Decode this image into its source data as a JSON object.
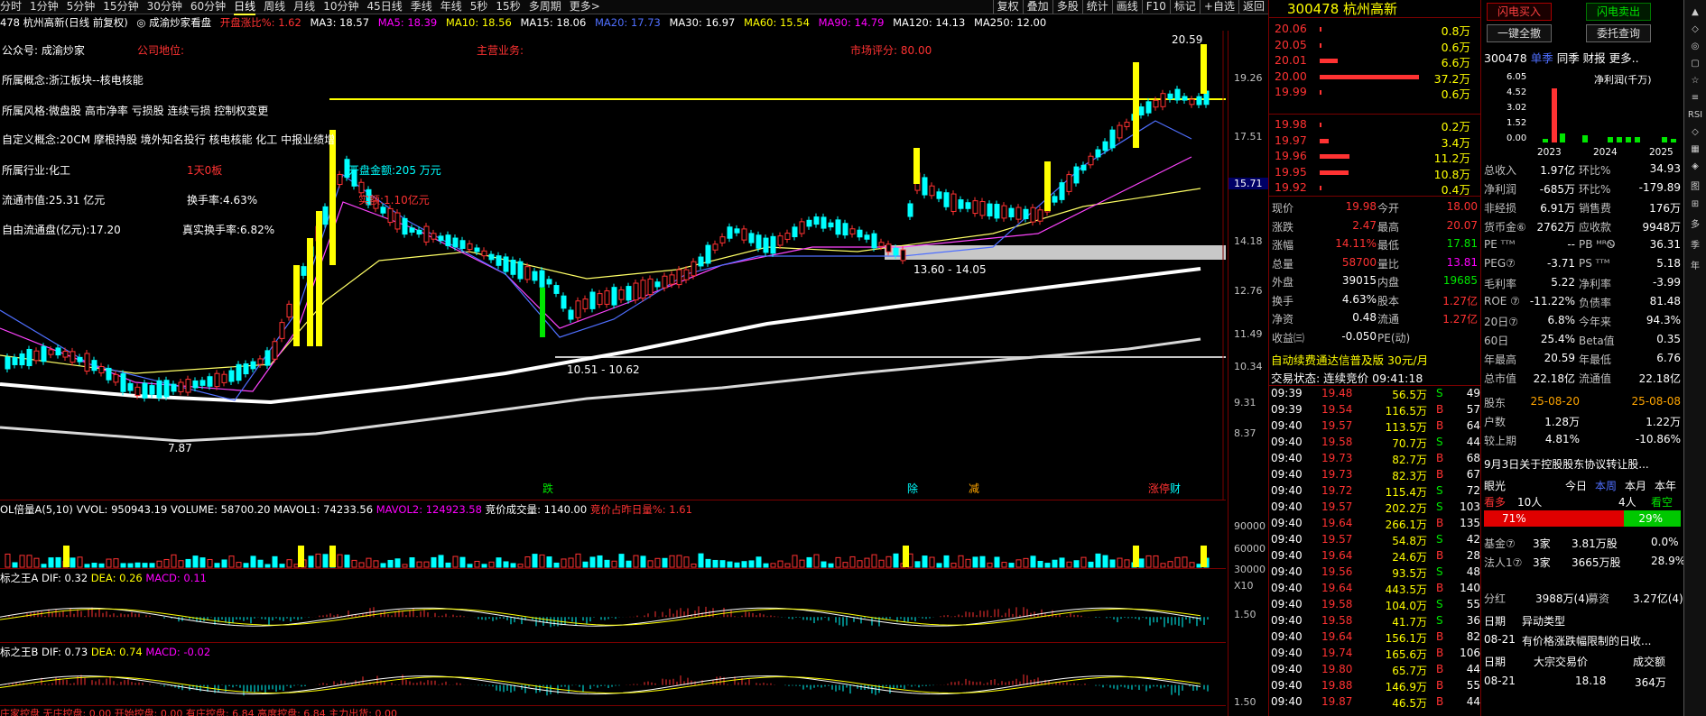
{
  "periods": [
    "分时",
    "1分钟",
    "5分钟",
    "15分钟",
    "30分钟",
    "60分钟",
    "日线",
    "周线",
    "月线",
    "10分钟",
    "45日线",
    "季线",
    "年线",
    "5秒",
    "15秒",
    "多周期",
    "更多>"
  ],
  "tools": [
    "复权",
    "叠加",
    "多股",
    "统计",
    "画线",
    "F10",
    "标记",
    "+自选",
    "返回"
  ],
  "ma": {
    "stock": "478 杭州高新(日线 前复权)",
    "tag": "◎ 成渝炒家看盘",
    "open_pct": "开盘涨比%: 1.62",
    "ma3": "MA3: 18.57",
    "ma5": "MA5: 18.39",
    "ma10": "MA10: 18.56",
    "ma15": "MA15: 18.06",
    "ma20": "MA20: 17.73",
    "ma30": "MA30: 16.97",
    "ma60": "MA60: 15.54",
    "ma90": "MA90: 14.79",
    "ma120": "MA120: 14.13",
    "ma250": "MA250: 12.00"
  },
  "ann": {
    "a1": "公众号: 成渝炒家",
    "a2": "公司地位:",
    "a3": "主营业务:",
    "a4": "市场评分: 80.00",
    "a5": "所属概念:浙江板块--核电核能",
    "a6": "所属风格:微盘股 高市净率 亏损股 连续亏损 控制权变更",
    "a7": "自定义概念:20CM 摩根持股 境外知名投行 核电核能 化工 中报业绩增",
    "a8": "所属行业:化工",
    "a9": "1天0板",
    "a10": "开盘金额:205 万元",
    "a11": "流通市值:25.31 亿元",
    "a12": "换手率:4.63%",
    "a13": "自由流通盘(亿元):17.20",
    "a14": "真实换手率:6.82%",
    "a15": "实额:1.10亿元",
    "hi": "20.59",
    "lo": "7.87",
    "r1": "13.60 - 14.05",
    "r2": "10.51 - 10.62",
    "m1": "跌",
    "m2": "除",
    "m3": "减",
    "m4": "涨停",
    "m5": "财"
  },
  "axis": [
    "19.26",
    "17.51",
    "15.71",
    "14.18",
    "12.76",
    "11.49",
    "10.34",
    "9.31",
    "8.37"
  ],
  "vol": {
    "title": "OL倍量A(5,10)",
    "vvol": "VVOL: 950943.19",
    "volume": "VOLUME: 58700.20",
    "mavol1": "MAVOL1: 74233.56",
    "mavol2": "MAVOL2: 124923.58",
    "bid": "竞价成交量: 1140.00",
    "bidpct": "竞价占昨日量%: 1.61",
    "ax": [
      "90000",
      "60000",
      "30000",
      "X10"
    ]
  },
  "macdA": {
    "title": "标之王A",
    "dif": "DIF: 0.32",
    "dea": "DEA: 0.26",
    "macd": "MACD: 0.11",
    "ax": "1.50"
  },
  "macdB": {
    "title": "标之王B",
    "dif": "DIF: 0.73",
    "dea": "DEA: 0.74",
    "macd": "MACD: -0.02",
    "ax": "1.50"
  },
  "bottom": "庄家控盘 无庄控盘: 0.00 开始控盘: 0.00 有庄控盘: 6.84 高度控盘: 6.84 主力出货: 0.00",
  "quote": {
    "code": "300478",
    "name": "杭州高新",
    "asks": [
      [
        "20.06",
        "0.8万"
      ],
      [
        "20.05",
        "0.6万"
      ],
      [
        "20.01",
        "6.6万"
      ],
      [
        "20.00",
        "37.2万"
      ],
      [
        "19.99",
        "0.6万"
      ]
    ],
    "bids": [
      [
        "19.98",
        "0.2万"
      ],
      [
        "19.97",
        "3.4万"
      ],
      [
        "19.96",
        "11.2万"
      ],
      [
        "19.95",
        "10.8万"
      ],
      [
        "19.92",
        "0.4万"
      ]
    ]
  },
  "stats": [
    [
      "现价",
      "19.98",
      "今开",
      "18.00"
    ],
    [
      "涨跌",
      "2.47",
      "最高",
      "20.07"
    ],
    [
      "涨幅",
      "14.11%",
      "最低",
      "17.81"
    ],
    [
      "总量",
      "58700",
      "量比",
      "13.81"
    ],
    [
      "外盘",
      "39015",
      "内盘",
      "19685"
    ],
    [
      "换手",
      "4.63%",
      "股本",
      "1.27亿"
    ],
    [
      "净资",
      "0.48",
      "流通",
      "1.27亿"
    ],
    [
      "收益㈢",
      "-0.050",
      "PE(动)",
      ""
    ]
  ],
  "promo": "自动续费通达信普及版  30元/月",
  "status": "交易状态: 连续竞价  09:41:18",
  "ticks": [
    [
      "09:39",
      "19.48",
      "56.5万",
      "S",
      "49"
    ],
    [
      "09:39",
      "19.54",
      "116.5万",
      "B",
      "57"
    ],
    [
      "09:40",
      "19.57",
      "113.5万",
      "B",
      "64"
    ],
    [
      "09:40",
      "19.58",
      "70.7万",
      "S",
      "44"
    ],
    [
      "09:40",
      "19.73",
      "82.7万",
      "B",
      "68"
    ],
    [
      "09:40",
      "19.73",
      "82.3万",
      "B",
      "67"
    ],
    [
      "09:40",
      "19.72",
      "115.4万",
      "S",
      "72"
    ],
    [
      "09:40",
      "19.57",
      "202.2万",
      "S",
      "103"
    ],
    [
      "09:40",
      "19.64",
      "266.1万",
      "B",
      "135"
    ],
    [
      "09:40",
      "19.57",
      "54.8万",
      "S",
      "42"
    ],
    [
      "09:40",
      "19.64",
      "24.6万",
      "B",
      "28"
    ],
    [
      "09:40",
      "19.56",
      "93.5万",
      "S",
      "48"
    ],
    [
      "09:40",
      "19.64",
      "443.5万",
      "B",
      "140"
    ],
    [
      "09:40",
      "19.58",
      "104.0万",
      "S",
      "55"
    ],
    [
      "09:40",
      "19.58",
      "41.7万",
      "S",
      "36"
    ],
    [
      "09:40",
      "19.64",
      "156.1万",
      "B",
      "82"
    ],
    [
      "09:40",
      "19.74",
      "165.6万",
      "B",
      "106"
    ],
    [
      "09:40",
      "19.80",
      "65.7万",
      "B",
      "44"
    ],
    [
      "09:40",
      "19.88",
      "146.9万",
      "B",
      "55"
    ],
    [
      "09:40",
      "19.87",
      "46.5万",
      "B",
      "44"
    ]
  ],
  "fin": {
    "btns": [
      "闪电买入",
      "闪电卖出",
      "一键全撤",
      "委托查询"
    ],
    "code": "300478",
    "tabs": [
      "单季",
      "同季",
      "财报",
      "更多.."
    ],
    "y": [
      "6.05",
      "4.52",
      "3.02",
      "1.52",
      "0.00"
    ],
    "unit": "净利润(千万)",
    "years": [
      "2023",
      "2024",
      "2025"
    ],
    "kv": [
      [
        "总收入",
        "1.97亿",
        "环比%",
        "34.93"
      ],
      [
        "净利润",
        "-685万",
        "环比%",
        "-179.89"
      ],
      [
        "非经损",
        "6.91万",
        "销售费",
        "176万"
      ],
      [
        "货币金⑥",
        "2762万",
        "应收款",
        "9948万"
      ],
      [
        "PE ᵀᵀᴹ",
        "--",
        "PB ᴹᴿᏫ",
        "36.31"
      ],
      [
        "PEG⑦",
        "-3.71",
        "PS ᵀᵀᴹ",
        "5.18"
      ],
      [
        "毛利率",
        "5.22",
        "净利率",
        "-3.99"
      ],
      [
        "ROE ⑦",
        "-11.22%",
        "负债率",
        "81.48"
      ],
      [
        "20日⑦",
        "6.8%",
        "今年来",
        "94.3%"
      ],
      [
        "60日",
        "25.4%",
        "Beta值",
        "0.35"
      ],
      [
        "年最高",
        "20.59",
        "年最低",
        "6.76"
      ],
      [
        "总市值",
        "22.18亿",
        "流通值",
        "22.18亿"
      ]
    ],
    "holders": [
      [
        "股东",
        "25-08-20",
        "25-08-08"
      ],
      [
        "户数",
        "1.28万",
        "1.22万"
      ],
      [
        "较上期",
        "4.81%",
        "-10.86%"
      ]
    ],
    "news": "9月3日关于控股股东协议转让股...",
    "eye": {
      "label": "眼光",
      "tabs": [
        "今日",
        "本周",
        "本月",
        "本年"
      ],
      "more": "看多",
      "more_n": "10人",
      "less_n": "4人",
      "less": "看空",
      "pct_up": "71%",
      "pct_dn": "29%"
    },
    "inst": [
      [
        "基金⑦",
        "3家",
        "3.81万股",
        "0.0%"
      ],
      [
        "法人1⑦",
        "3家",
        "3665万股",
        "28.9%"
      ]
    ],
    "fh": [
      "分红",
      "3988万(4)",
      "募资",
      "3.27亿(4)"
    ],
    "anom": {
      "h1": "日期",
      "h2": "异动类型",
      "d": "08-21",
      "t": "有价格涨跌幅限制的日收..."
    },
    "block": {
      "h1": "日期",
      "h2": "大宗交易价",
      "h3": "成交额",
      "d": "08-21",
      "p": "18.18",
      "a": "364万"
    }
  },
  "sidebar": [
    "▲",
    "◇",
    "◎",
    "▢",
    "☆",
    "≡",
    "RSI",
    "◇",
    "▦",
    "◈",
    "图",
    "⊞",
    "多",
    "季",
    "年"
  ]
}
